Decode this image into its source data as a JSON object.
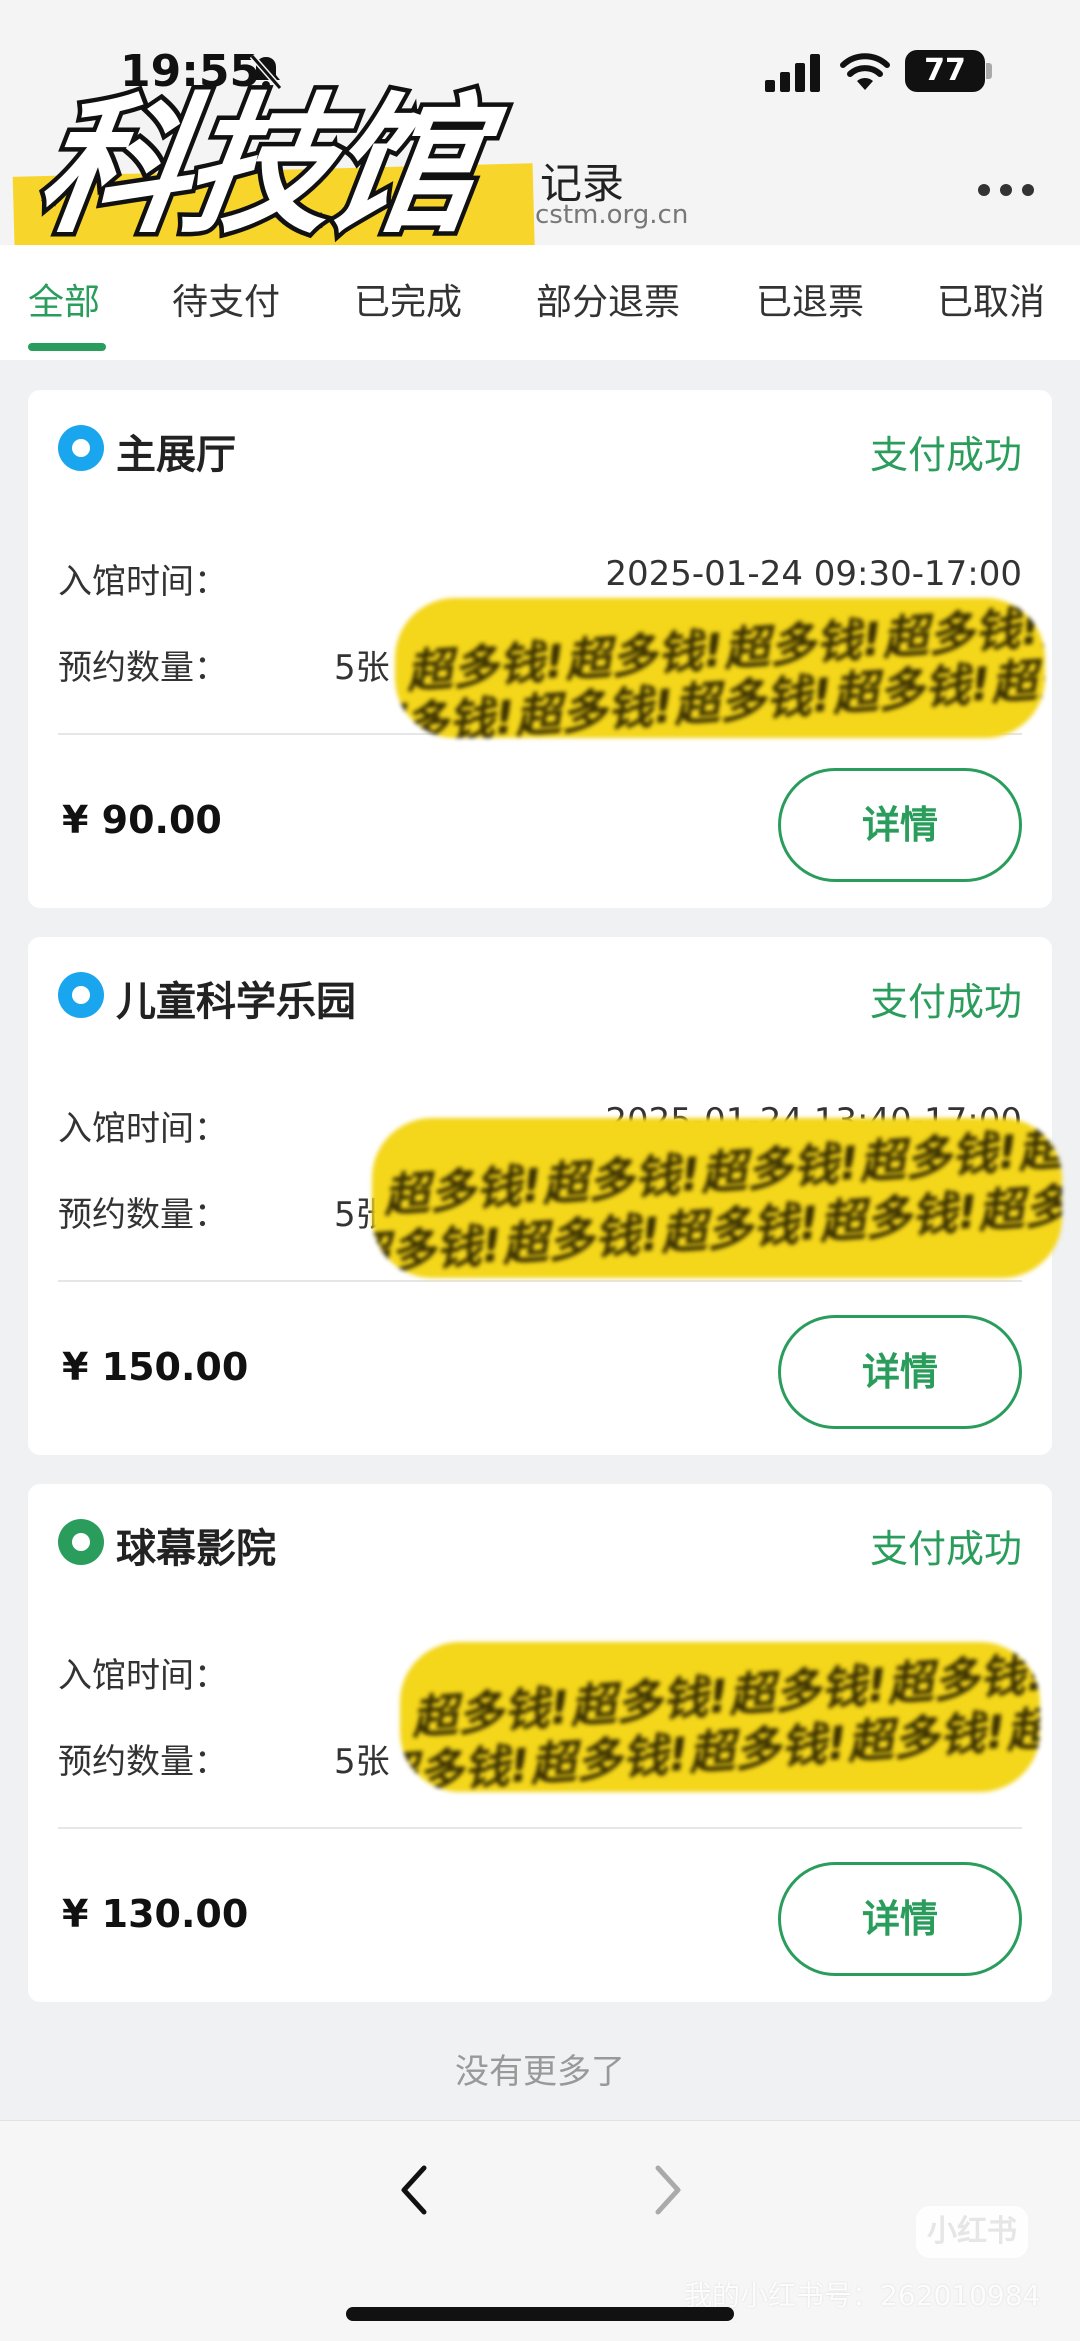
{
  "status_bar": {
    "time": "19:55",
    "battery": "77"
  },
  "header": {
    "title": "记录",
    "subtitle": "cstm.org.cn"
  },
  "sticker": {
    "text": "科技馆"
  },
  "tabs": [
    {
      "label": "全部"
    },
    {
      "label": "待支付"
    },
    {
      "label": "已完成"
    },
    {
      "label": "部分退票"
    },
    {
      "label": "已退票"
    },
    {
      "label": "已取消"
    }
  ],
  "orders": [
    {
      "venue": "主展厅",
      "status": "支付成功",
      "time_label": "入馆时间：",
      "time_value": "2025-01-24 09:30-17:00",
      "qty_label": "预约数量：",
      "qty_value": "5张",
      "price": "¥ 90.00",
      "detail_label": "详情",
      "dot_color": "#1aa6ee"
    },
    {
      "venue": "儿童科学乐园",
      "status": "支付成功",
      "time_label": "入馆时间：",
      "time_value": "2025-01-24 13:40-17:00",
      "qty_label": "预约数量：",
      "qty_value": "5张",
      "price": "¥ 150.00",
      "detail_label": "详情",
      "dot_color": "#1aa6ee"
    },
    {
      "venue": "球幕影院",
      "status": "支付成功",
      "time_label": "入馆时间：",
      "time_value": "",
      "qty_label": "预约数量：",
      "qty_value": "5张",
      "price": "¥ 130.00",
      "detail_label": "详情",
      "dot_color": "#2a9d5c"
    }
  ],
  "annotation": {
    "scribble_text": "超多钱!超多钱!超多钱!超多钱!超多钱!"
  },
  "footer": {
    "end_text": "没有更多了"
  },
  "watermark": {
    "logo": "小红书",
    "text": "我的小红书号：262010984"
  },
  "colors": {
    "accent": "#2a9d5c",
    "highlight": "#f4d61a",
    "dot_blue": "#1aa6ee"
  }
}
